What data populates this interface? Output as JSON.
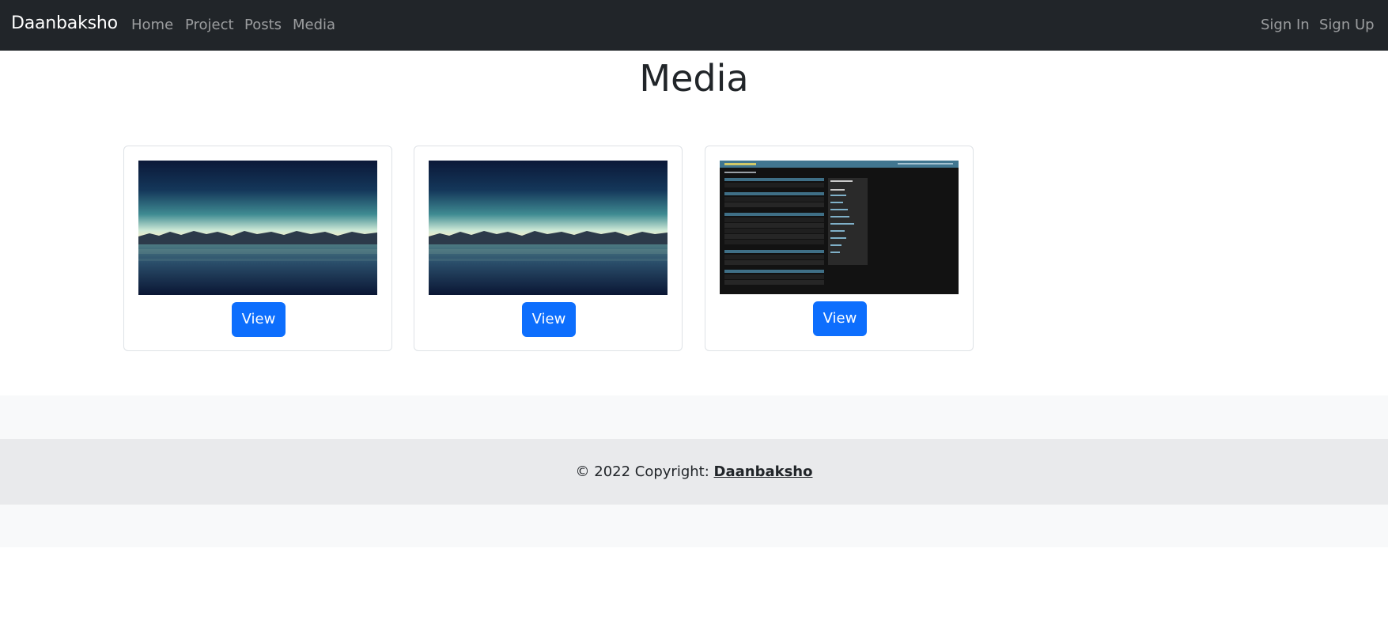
{
  "navbar": {
    "brand": "Daanbaksho",
    "links": [
      "Home",
      "Project",
      "Posts",
      "Media"
    ],
    "auth": [
      "Sign In",
      "Sign Up"
    ]
  },
  "page": {
    "title": "Media"
  },
  "media": [
    {
      "image": "night-lake-landscape-image",
      "button_label": "View"
    },
    {
      "image": "night-lake-landscape-image",
      "button_label": "View"
    },
    {
      "image": "django-admin-screenshot-image",
      "button_label": "View"
    }
  ],
  "footer": {
    "copyright_text": "© 2022 Copyright: ",
    "copyright_link": "Daanbaksho"
  },
  "colors": {
    "navbar": "#212529",
    "primary": "#0d6efd",
    "footer_band": "#f8f9fa",
    "copyright_bar": "#e9eaec"
  }
}
